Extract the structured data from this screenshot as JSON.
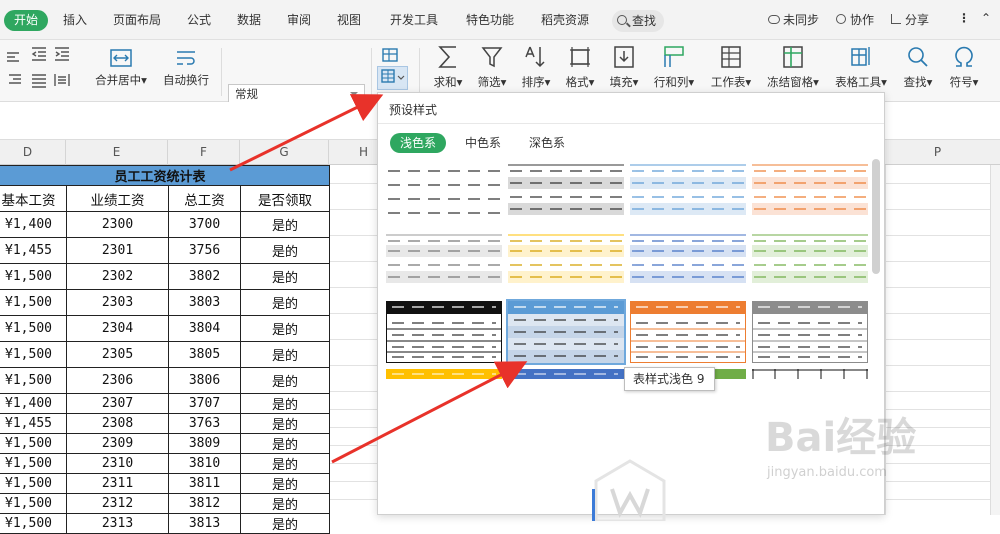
{
  "menubar": {
    "active_tab": "开始",
    "tabs": [
      "插入",
      "页面布局",
      "公式",
      "数据",
      "审阅",
      "视图",
      "开发工具",
      "特色功能",
      "稻壳资源"
    ],
    "search": "查找",
    "right": [
      "未同步",
      "协作",
      "分享"
    ]
  },
  "toolbar": {
    "merge_label": "合并居中▾",
    "wrap_label": "自动换行",
    "number_format": "常规",
    "currency_symbol": "¥",
    "buttons": [
      {
        "label": "求和▾"
      },
      {
        "label": "筛选▾"
      },
      {
        "label": "排序▾"
      },
      {
        "label": "格式▾"
      },
      {
        "label": "填充▾"
      },
      {
        "label": "行和列▾"
      },
      {
        "label": "工作表▾"
      },
      {
        "label": "冻结窗格▾"
      },
      {
        "label": "表格工具▾"
      },
      {
        "label": "查找▾"
      },
      {
        "label": "符号▾"
      }
    ]
  },
  "columns": [
    "D",
    "E",
    "F",
    "G",
    "H",
    "P"
  ],
  "table": {
    "title": "员工工资统计表",
    "headers": [
      "基本工资",
      "业绩工资",
      "总工资",
      "是否领取"
    ],
    "rows": [
      [
        "¥1,400",
        "2300",
        "3700",
        "是的"
      ],
      [
        "¥1,455",
        "2301",
        "3756",
        "是的"
      ],
      [
        "¥1,500",
        "2302",
        "3802",
        "是的"
      ],
      [
        "¥1,500",
        "2303",
        "3803",
        "是的"
      ],
      [
        "¥1,500",
        "2304",
        "3804",
        "是的"
      ],
      [
        "¥1,500",
        "2305",
        "3805",
        "是的"
      ],
      [
        "¥1,500",
        "2306",
        "3806",
        "是的"
      ],
      [
        "¥1,400",
        "2307",
        "3707",
        "是的"
      ],
      [
        "¥1,455",
        "2308",
        "3763",
        "是的"
      ],
      [
        "¥1,500",
        "2309",
        "3809",
        "是的"
      ],
      [
        "¥1,500",
        "2310",
        "3810",
        "是的"
      ],
      [
        "¥1,500",
        "2311",
        "3811",
        "是的"
      ],
      [
        "¥1,500",
        "2312",
        "3812",
        "是的"
      ],
      [
        "¥1,500",
        "2313",
        "3813",
        "是的"
      ]
    ]
  },
  "popup": {
    "title": "预设样式",
    "tabs": [
      "浅色系",
      "中色系",
      "深色系"
    ],
    "tooltip": "表样式浅色 9"
  },
  "watermark": {
    "brand": "Bai经验",
    "url": "jingyan.baidu.com"
  },
  "colors": {
    "accent": "#2fa760",
    "table_title": "#5b9bd5",
    "arrow": "#e8322a"
  }
}
